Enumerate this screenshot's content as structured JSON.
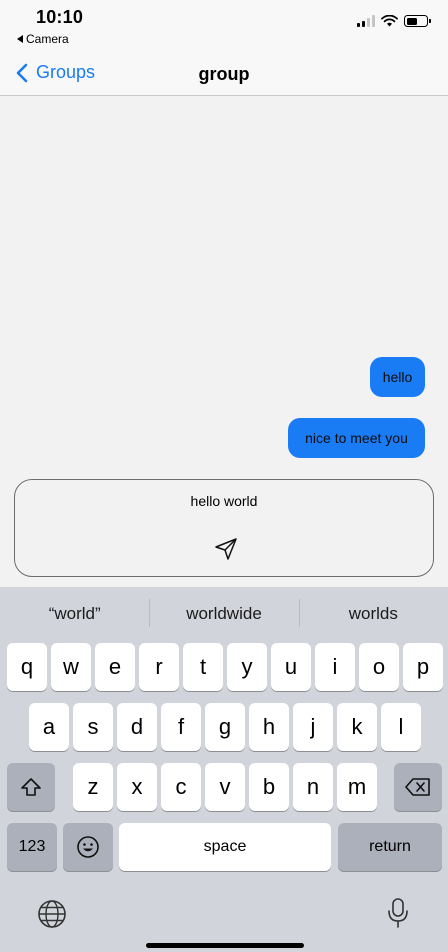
{
  "status_bar": {
    "time": "10:10",
    "back_app_label": "Camera"
  },
  "nav": {
    "back_label": "Groups",
    "title": "group"
  },
  "messages": [
    {
      "text": "hello",
      "sender": "me"
    },
    {
      "text": "nice to meet you",
      "sender": "me"
    }
  ],
  "composer": {
    "value": "hello world"
  },
  "keyboard": {
    "suggestions": [
      "“world”",
      "worldwide",
      "worlds"
    ],
    "row1": [
      "q",
      "w",
      "e",
      "r",
      "t",
      "y",
      "u",
      "i",
      "o",
      "p"
    ],
    "row2": [
      "a",
      "s",
      "d",
      "f",
      "g",
      "h",
      "j",
      "k",
      "l"
    ],
    "row3": [
      "z",
      "x",
      "c",
      "v",
      "b",
      "n",
      "m"
    ],
    "numbers_label": "123",
    "space_label": "space",
    "return_label": "return"
  },
  "colors": {
    "accent": "#1a7cf5",
    "background": "#f2f2f2",
    "keyboard_bg": "#d1d4da"
  }
}
